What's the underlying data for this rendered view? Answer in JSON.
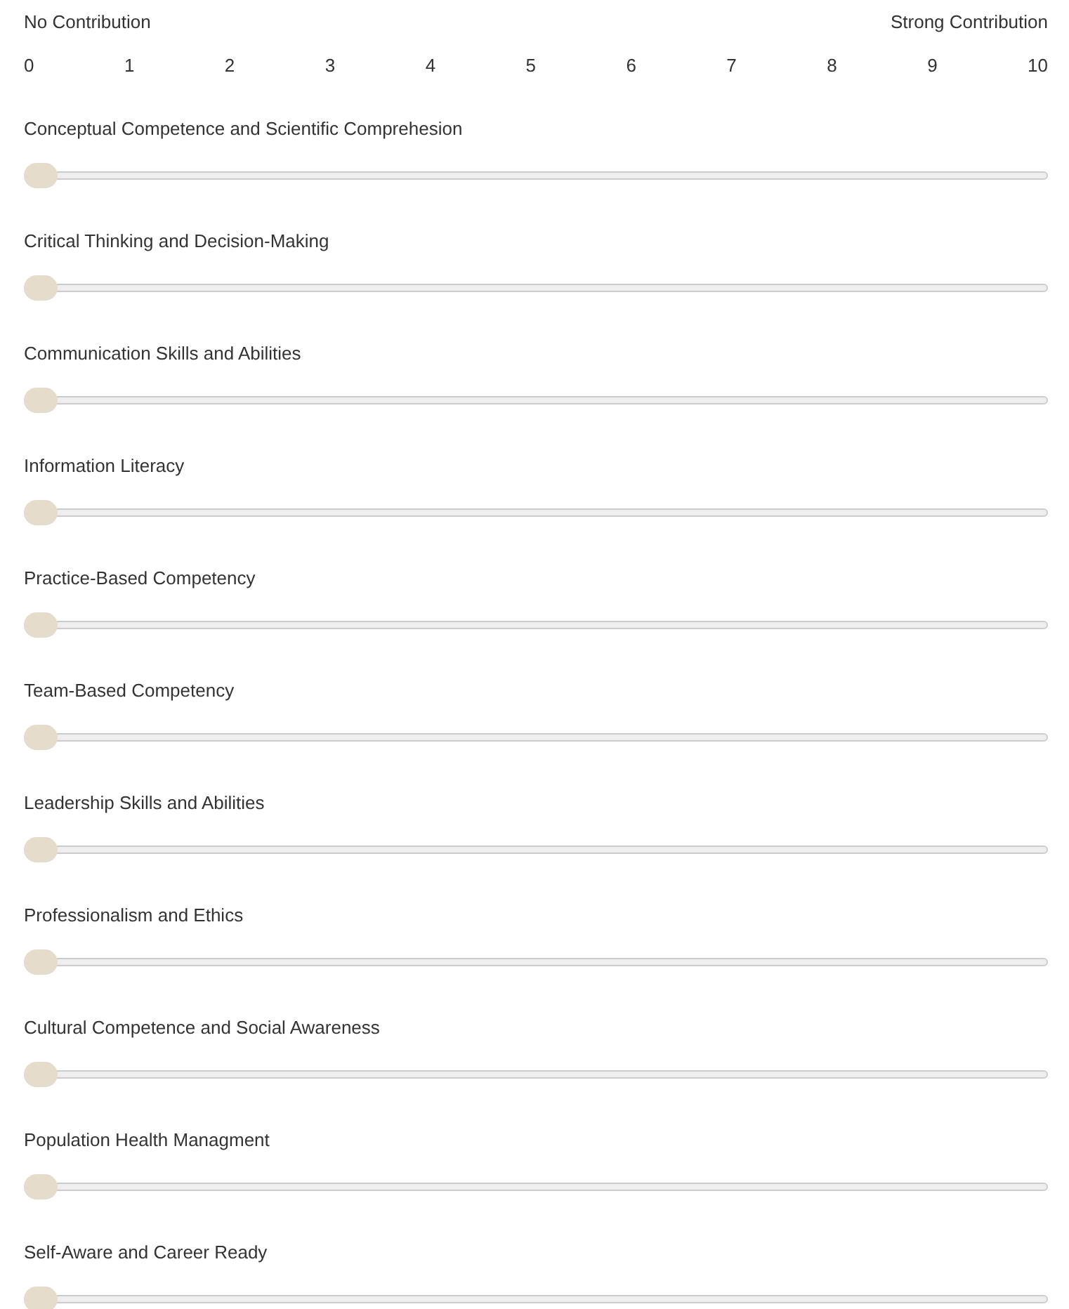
{
  "scale": {
    "min_label": "No Contribution",
    "max_label": "Strong Contribution",
    "ticks": [
      "0",
      "1",
      "2",
      "3",
      "4",
      "5",
      "6",
      "7",
      "8",
      "9",
      "10"
    ]
  },
  "items": [
    {
      "label": "Conceptual Competence and Scientific Comprehesion",
      "level": 0
    },
    {
      "label": "Critical Thinking and Decision-Making",
      "level": 0
    },
    {
      "label": "Communication Skills and Abilities",
      "level": 0
    },
    {
      "label": "Information Literacy",
      "level": 0
    },
    {
      "label": "Practice-Based Competency",
      "level": 0
    },
    {
      "label": "Team-Based Competency",
      "level": 0
    },
    {
      "label": "Leadership Skills and Abilities",
      "level": 0
    },
    {
      "label": "Professionalism and Ethics",
      "level": 0
    },
    {
      "label": "Cultural Competence and Social Awareness",
      "level": 0
    },
    {
      "label": "Population Health Managment",
      "level": 0
    },
    {
      "label": "Self-Aware and Career Ready",
      "level": 0
    }
  ]
}
